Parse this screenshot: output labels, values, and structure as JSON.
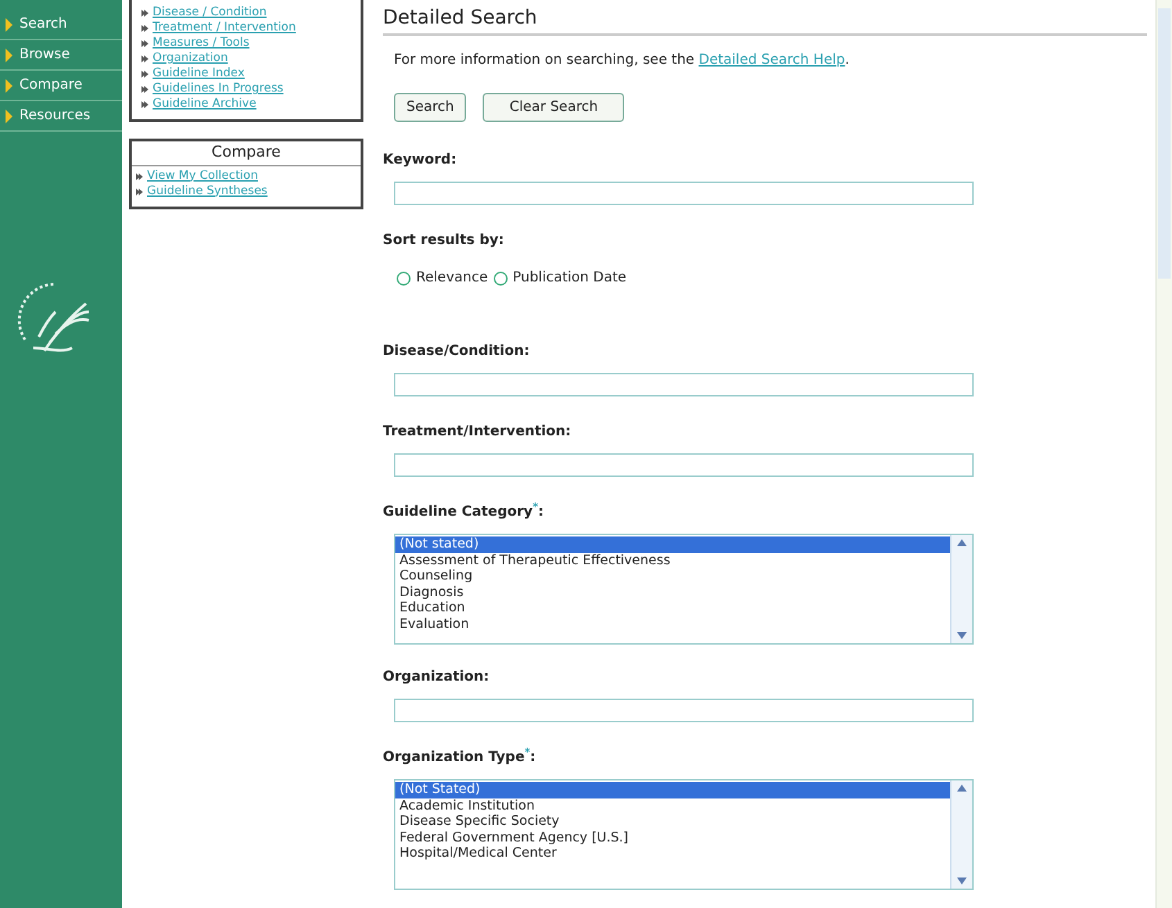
{
  "sidebar": {
    "items": [
      {
        "label": "Search"
      },
      {
        "label": "Browse"
      },
      {
        "label": "Compare"
      },
      {
        "label": "Resources"
      }
    ]
  },
  "link_boxes": [
    {
      "links": [
        "Disease / Condition",
        "Treatment / Intervention",
        "Measures / Tools",
        "Organization",
        "Guideline Index",
        "Guidelines In Progress",
        "Guideline Archive"
      ]
    },
    {
      "title": "Compare",
      "links": [
        "View My Collection",
        "Guideline Syntheses"
      ]
    }
  ],
  "main": {
    "title": "Detailed Search",
    "intro": "For more information on searching, see the ",
    "intro_link": "Detailed Search Help",
    "intro_end": ".",
    "buttons": [
      "Search",
      "Clear Search"
    ],
    "fields": [
      {
        "kind": "text",
        "label": "Keyword:"
      },
      {
        "kind": "radio",
        "label": "Sort results by:",
        "options": [
          {
            "label": "Relevance",
            "selected": false
          },
          {
            "label": "Publication Date",
            "selected": false
          }
        ]
      },
      {
        "kind": "text",
        "label": "Disease/Condition:"
      },
      {
        "kind": "text",
        "label": "Treatment/Intervention:"
      },
      {
        "kind": "list",
        "label": "Guideline Category$^{*}$:",
        "options": [
          {
            "label": "(Not stated)",
            "selected": true
          },
          {
            "label": "Assessment of Therapeutic Effectiveness",
            "selected": false
          },
          {
            "label": "Counseling",
            "selected": false
          },
          {
            "label": "Diagnosis",
            "selected": false
          },
          {
            "label": "Education",
            "selected": false
          },
          {
            "label": "Evaluation",
            "selected": false
          }
        ]
      },
      {
        "kind": "text",
        "label": "Organization:"
      },
      {
        "kind": "list",
        "label": "Organization Type$^{*}$:",
        "options": [
          {
            "label": "(Not Stated)",
            "selected": true
          },
          {
            "label": "Academic Institution",
            "selected": false
          },
          {
            "label": "Disease Specific Society",
            "selected": false
          },
          {
            "label": "Federal Government Agency [U.S.]",
            "selected": false
          },
          {
            "label": "Hospital/Medical Center",
            "selected": false
          }
        ]
      }
    ]
  }
}
